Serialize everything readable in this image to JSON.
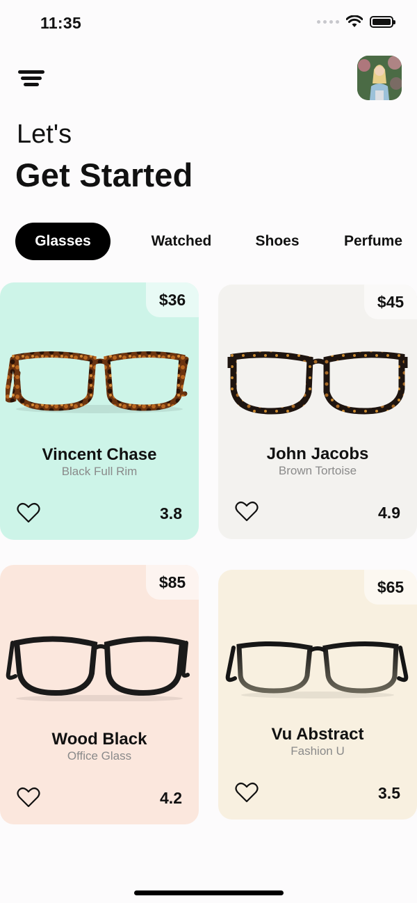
{
  "status": {
    "time": "11:35"
  },
  "header": {
    "greeting": "Let's",
    "title": "Get Started"
  },
  "tabs": [
    {
      "label": "Glasses",
      "active": true
    },
    {
      "label": "Watched",
      "active": false
    },
    {
      "label": "Shoes",
      "active": false
    },
    {
      "label": "Perfume",
      "active": false
    }
  ],
  "products": [
    {
      "price": "$36",
      "name": "Vincent Chase",
      "subtitle": "Black Full Rim",
      "rating": "3.8",
      "background": "#cdf4e8",
      "frame": "tortoise"
    },
    {
      "price": "$45",
      "name": "John Jacobs",
      "subtitle": "Brown Tortoise",
      "rating": "4.9",
      "background": "#f3f2ef",
      "frame": "dark-tortoise"
    },
    {
      "price": "$85",
      "name": "Wood Black",
      "subtitle": "Office Glass",
      "rating": "4.2",
      "background": "#fbe7dd",
      "frame": "black-round"
    },
    {
      "price": "$65",
      "name": "Vu Abstract",
      "subtitle": "Fashion U",
      "rating": "3.5",
      "background": "#f8f0e0",
      "frame": "black-fade"
    }
  ],
  "colors": {
    "accent": "#000000",
    "muted_text": "#8a8a8a"
  }
}
